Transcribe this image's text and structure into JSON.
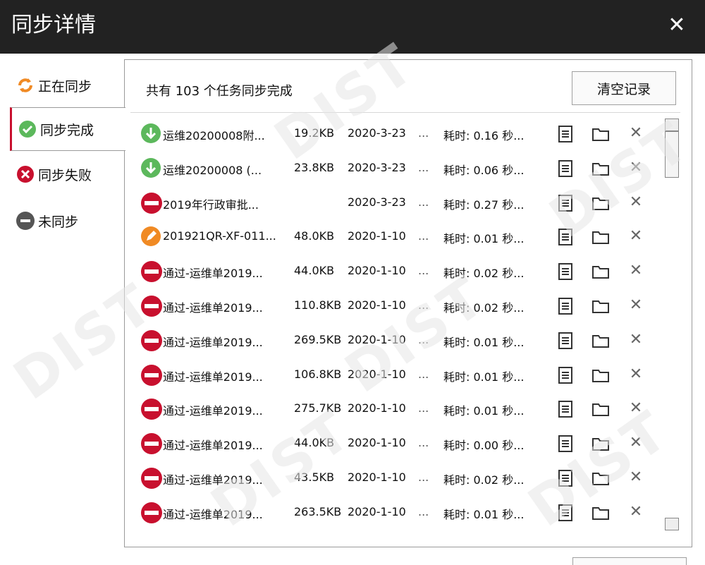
{
  "window": {
    "title": "同步详情",
    "close_label": "✕"
  },
  "sidebar": {
    "items": [
      {
        "label": "正在同步",
        "icon": "sync-icon",
        "active": false
      },
      {
        "label": "同步完成",
        "icon": "check-icon",
        "active": true
      },
      {
        "label": "同步失败",
        "icon": "error-icon",
        "active": false
      },
      {
        "label": "未同步",
        "icon": "minus-icon",
        "active": false
      }
    ]
  },
  "panel": {
    "summary": "共有 103 个任务同步完成",
    "clear_label": "清空记录"
  },
  "tasks": [
    {
      "status": "download",
      "name": "运维20200008附...",
      "size": "19.2KB",
      "date": "2020-3-23",
      "dots": "...",
      "time": "耗时: 0.16 秒..."
    },
    {
      "status": "download",
      "name": "运维20200008 (...",
      "size": "23.8KB",
      "date": "2020-3-23",
      "dots": "...",
      "time": "耗时: 0.06 秒..."
    },
    {
      "status": "blocked",
      "name": "2019年行政审批...",
      "size": "",
      "date": "2020-3-23",
      "dots": "...",
      "time": "耗时: 0.27 秒..."
    },
    {
      "status": "edit",
      "name": "201921QR-XF-011...",
      "size": "48.0KB",
      "date": "2020-1-10",
      "dots": "...",
      "time": "耗时: 0.01 秒..."
    },
    {
      "status": "blocked",
      "name": "通过-运维单2019...",
      "size": "44.0KB",
      "date": "2020-1-10",
      "dots": "...",
      "time": "耗时: 0.02 秒..."
    },
    {
      "status": "blocked",
      "name": "通过-运维单2019...",
      "size": "110.8KB",
      "date": "2020-1-10",
      "dots": "...",
      "time": "耗时: 0.02 秒..."
    },
    {
      "status": "blocked",
      "name": "通过-运维单2019...",
      "size": "269.5KB",
      "date": "2020-1-10",
      "dots": "...",
      "time": "耗时: 0.01 秒..."
    },
    {
      "status": "blocked",
      "name": "通过-运维单2019...",
      "size": "106.8KB",
      "date": "2020-1-10",
      "dots": "...",
      "time": "耗时: 0.01 秒..."
    },
    {
      "status": "blocked",
      "name": "通过-运维单2019...",
      "size": "275.7KB",
      "date": "2020-1-10",
      "dots": "...",
      "time": "耗时: 0.01 秒..."
    },
    {
      "status": "blocked",
      "name": "通过-运维单2019...",
      "size": "44.0KB",
      "date": "2020-1-10",
      "dots": "...",
      "time": "耗时: 0.00 秒..."
    },
    {
      "status": "blocked",
      "name": "通过-运维单2019...",
      "size": "43.5KB",
      "date": "2020-1-10",
      "dots": "...",
      "time": "耗时: 0.02 秒..."
    },
    {
      "status": "blocked",
      "name": "通过-运维单2019...",
      "size": "263.5KB",
      "date": "2020-1-10",
      "dots": "...",
      "time": "耗时: 0.01 秒..."
    }
  ],
  "watermark": {
    "text": "DIST"
  },
  "colors": {
    "titlebar": "#222222",
    "accent": "#c8102e",
    "success": "#5cb85c",
    "orange": "#f08a24",
    "blocked": "#c8102e"
  }
}
